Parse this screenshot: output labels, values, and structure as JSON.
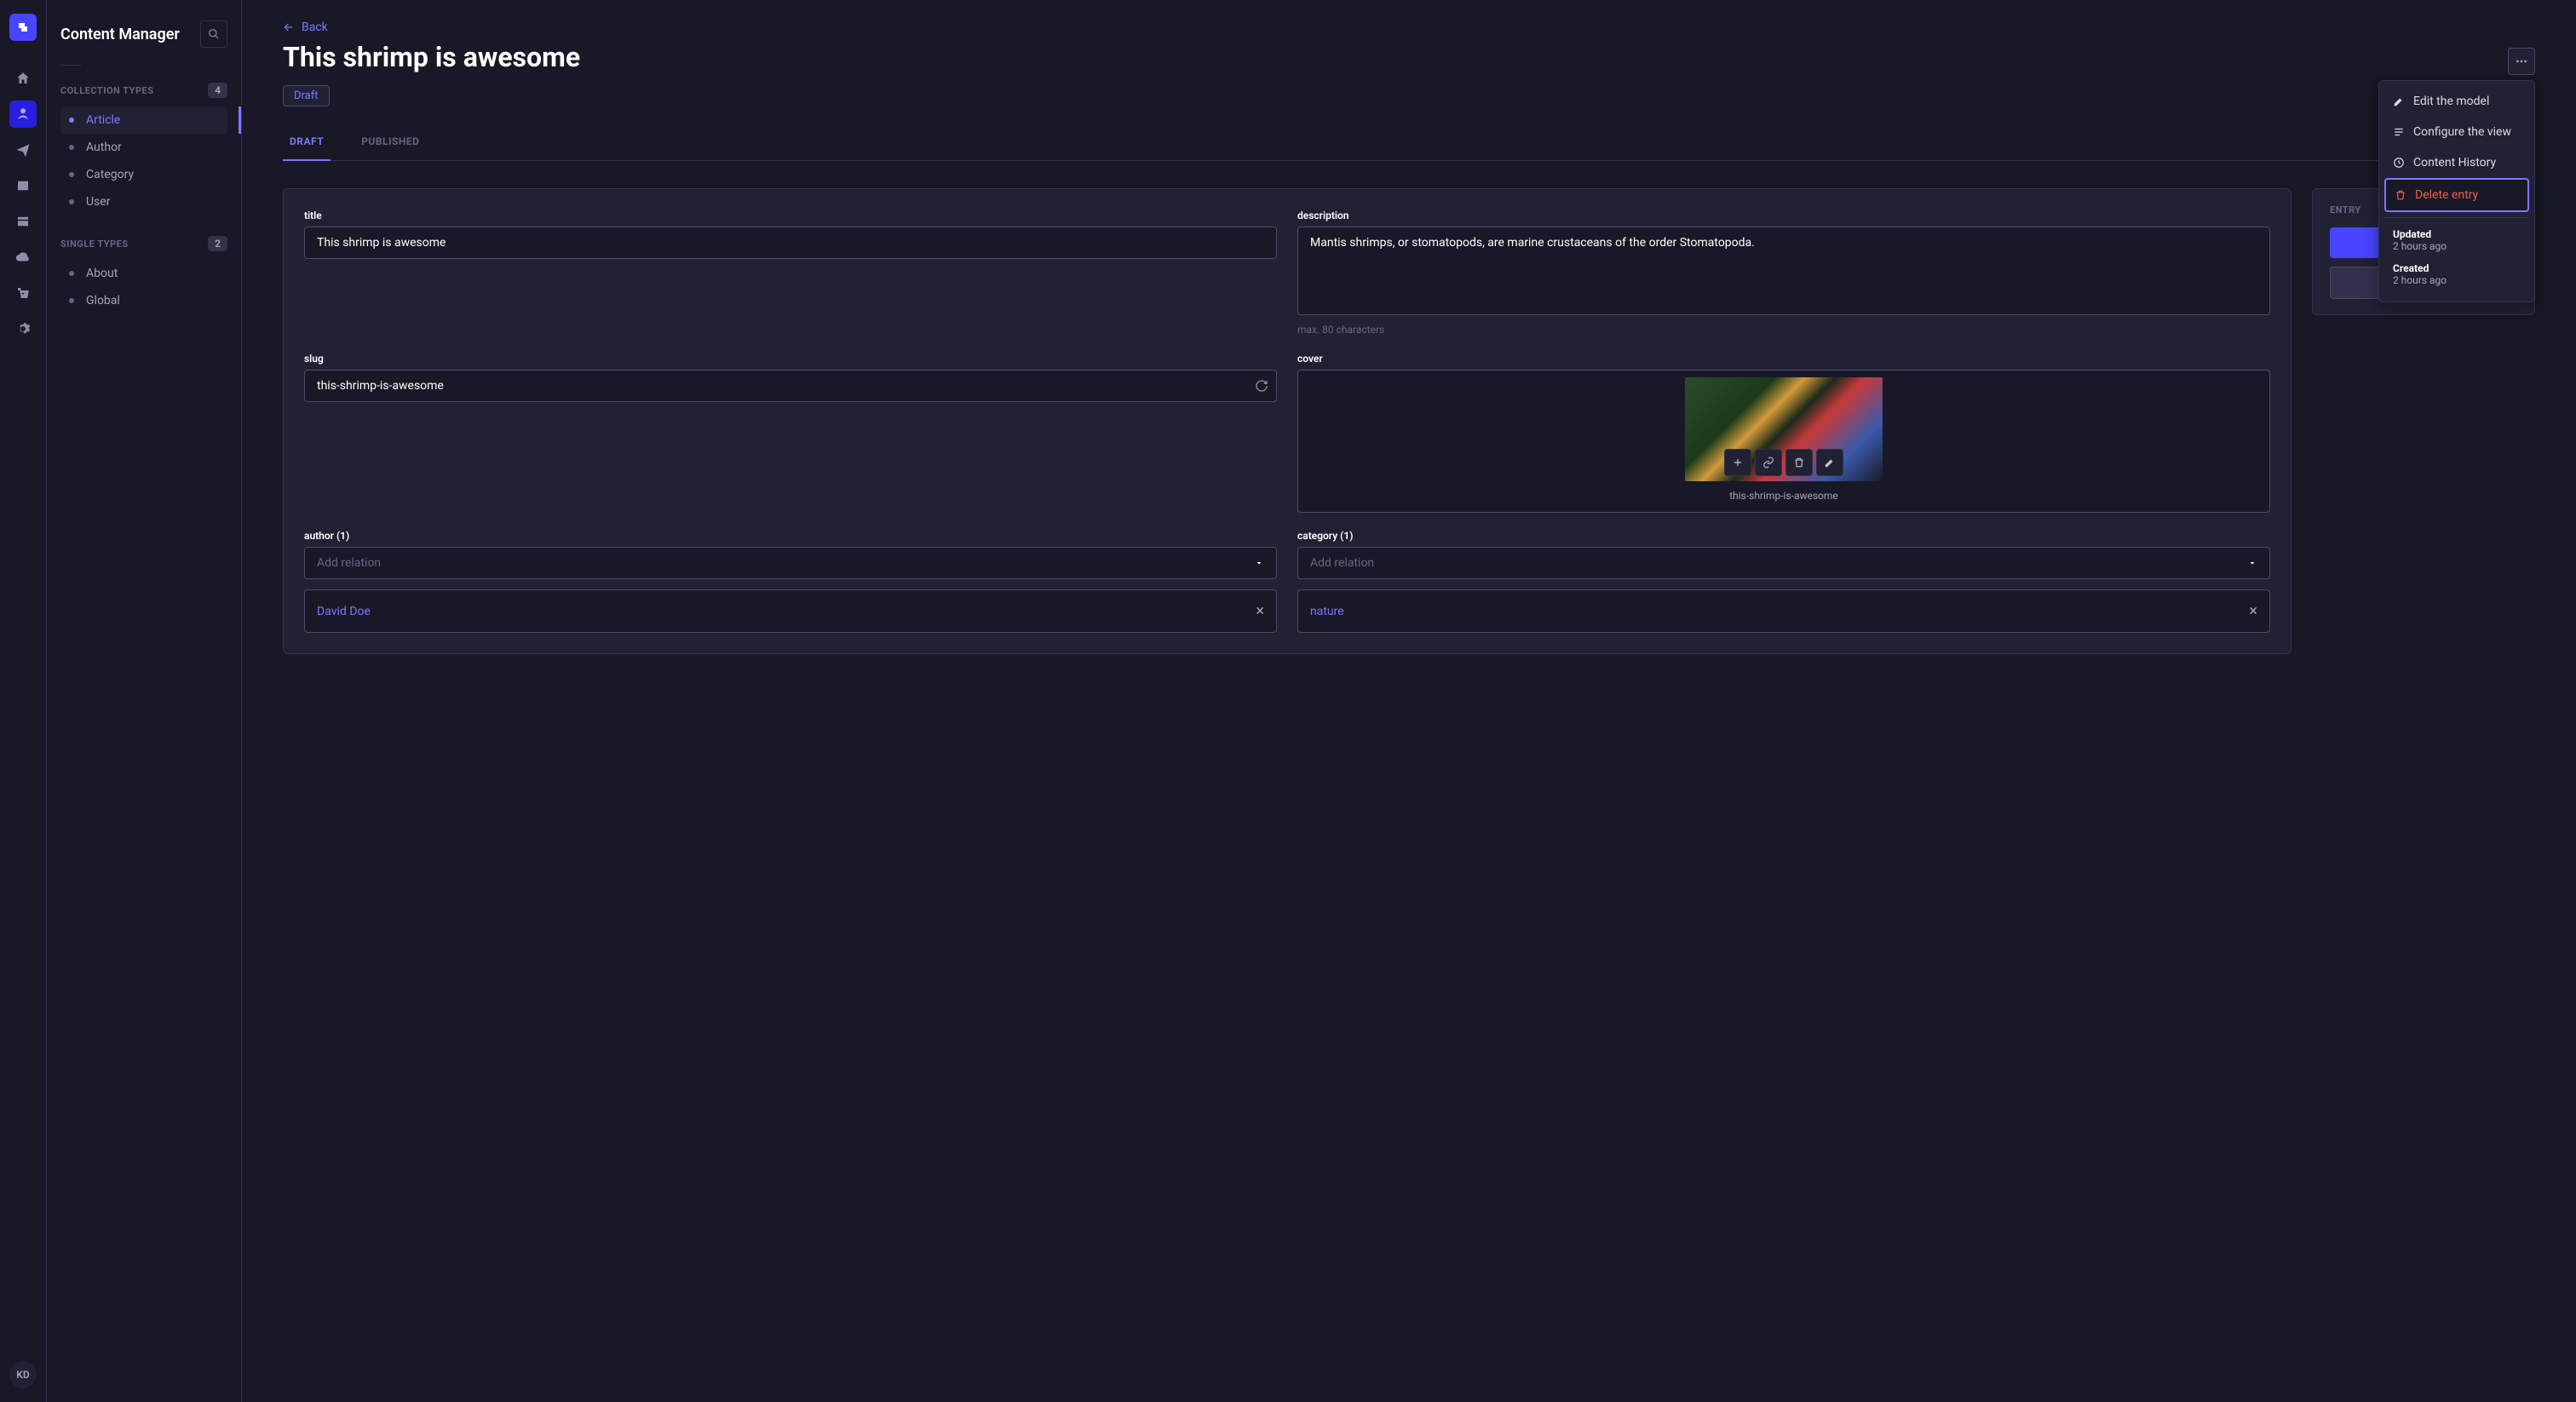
{
  "sidebar": {
    "title": "Content Manager",
    "collection_types_label": "COLLECTION TYPES",
    "collection_count": "4",
    "collection_items": [
      "Article",
      "Author",
      "Category",
      "User"
    ],
    "single_types_label": "SINGLE TYPES",
    "single_count": "2",
    "single_items": [
      "About",
      "Global"
    ]
  },
  "rail": {
    "avatar": "KD"
  },
  "header": {
    "back": "Back",
    "title": "This shrimp is awesome",
    "status": "Draft"
  },
  "tabs": {
    "draft": "DRAFT",
    "published": "PUBLISHED"
  },
  "form": {
    "title_label": "title",
    "title_value": "This shrimp is awesome",
    "description_label": "description",
    "description_value": "Mantis shrimps, or stomatopods, are marine crustaceans of the order Stomatopoda.",
    "description_helper": "max. 80 characters",
    "slug_label": "slug",
    "slug_value": "this-shrimp-is-awesome",
    "cover_label": "cover",
    "cover_caption": "this-shrimp-is-awesome",
    "author_label": "author (1)",
    "author_placeholder": "Add relation",
    "author_value": "David Doe",
    "category_label": "category (1)",
    "category_placeholder": "Add relation",
    "category_value": "nature"
  },
  "entry_panel": {
    "header": "ENTRY"
  },
  "dropdown": {
    "edit_model": "Edit the model",
    "configure_view": "Configure the view",
    "content_history": "Content History",
    "delete_entry": "Delete entry",
    "updated_label": "Updated",
    "updated_value": "2 hours ago",
    "created_label": "Created",
    "created_value": "2 hours ago"
  }
}
